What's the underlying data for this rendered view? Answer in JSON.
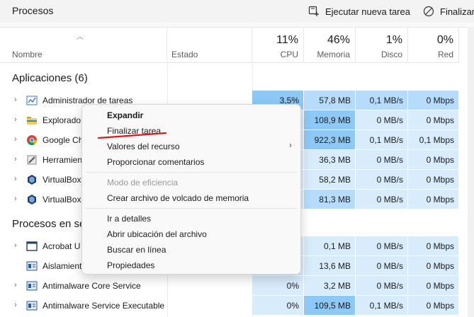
{
  "header": {
    "title": "Procesos",
    "run_task_label": "Ejecutar nueva tarea",
    "end_task_label": "Finalizar"
  },
  "columns": {
    "name": "Nombre",
    "status": "Estado",
    "cpu": {
      "pct": "11%",
      "label": "CPU"
    },
    "memory": {
      "pct": "46%",
      "label": "Memoria"
    },
    "disk": {
      "pct": "1%",
      "label": "Disco"
    },
    "network": {
      "pct": "0%",
      "label": "Red"
    }
  },
  "apps_section": "Aplicaciones (6)",
  "bg_section": "Procesos en se",
  "rows": [
    {
      "name": "Administrador de tareas",
      "icon": "task-manager-icon",
      "cpu": "3,5%",
      "mem": "57,8 MB",
      "disk": "0,1 MB/s",
      "net": "0 Mbps"
    },
    {
      "name": "Explorado",
      "icon": "folder-icon",
      "cpu": "",
      "mem": "108,9 MB",
      "disk": "0 MB/s",
      "net": "0 Mbps"
    },
    {
      "name": "Google Ch",
      "icon": "chrome-icon",
      "cpu": "",
      "mem": "922,3 MB",
      "disk": "0,1 MB/s",
      "net": "0,1 Mbps"
    },
    {
      "name": "Herramien",
      "icon": "tool-icon",
      "cpu": "",
      "mem": "36,3 MB",
      "disk": "0 MB/s",
      "net": "0 Mbps"
    },
    {
      "name": "VirtualBox",
      "icon": "virtualbox-icon",
      "cpu": "",
      "mem": "58,2 MB",
      "disk": "0 MB/s",
      "net": "0 Mbps"
    },
    {
      "name": "VirtualBox",
      "icon": "virtualbox-icon",
      "cpu": "",
      "mem": "81,3 MB",
      "disk": "0 MB/s",
      "net": "0 Mbps"
    },
    {
      "name": "Acrobat U",
      "icon": "window-icon",
      "cpu": "",
      "mem": "0,1 MB",
      "disk": "0 MB/s",
      "net": "0 Mbps"
    },
    {
      "name": "Aislamient",
      "icon": "service-icon",
      "cpu": "",
      "mem": "13,6 MB",
      "disk": "0 MB/s",
      "net": "0 Mbps"
    },
    {
      "name": "Antimalware Core Service",
      "icon": "service-icon",
      "cpu": "0%",
      "mem": "3,2 MB",
      "disk": "0 MB/s",
      "net": "0 Mbps"
    },
    {
      "name": "Antimalware Service Executable",
      "icon": "service-icon",
      "cpu": "0%",
      "mem": "109,5 MB",
      "disk": "0,1 MB/s",
      "net": "0 Mbps"
    }
  ],
  "context_menu": {
    "expand": "Expandir",
    "end_task": "Finalizar tarea",
    "resource_values": "Valores del recurso",
    "feedback": "Proporcionar comentarios",
    "efficiency_mode": "Modo de eficiencia",
    "dump_file": "Crear archivo de volcado de memoria",
    "details": "Ir a detalles",
    "open_location": "Abrir ubicación del archivo",
    "search_online": "Buscar en línea",
    "properties": "Propiedades"
  },
  "colors": {
    "heat_light": "#d9ecfc",
    "heat_mid": "#b7dcfb",
    "heat_strong": "#8ec8f7",
    "annotation": "#e8141a"
  }
}
